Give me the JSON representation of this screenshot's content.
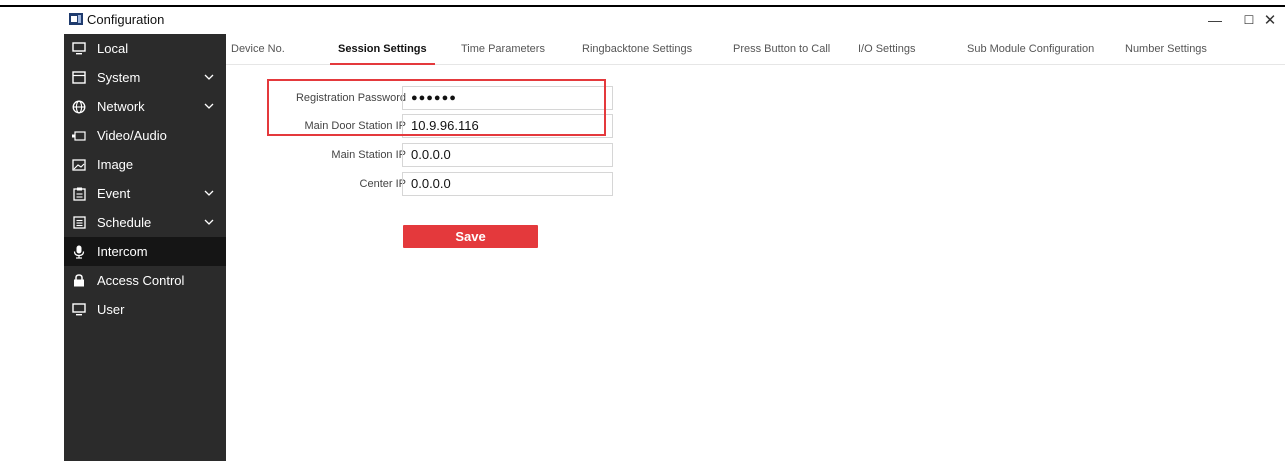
{
  "window": {
    "title": "Configuration",
    "minimize_label": "—",
    "maximize_label": "☐",
    "close_label": "✕"
  },
  "sidebar": {
    "items": [
      {
        "label": "Local",
        "icon": "monitor-icon"
      },
      {
        "label": "System",
        "icon": "system-icon",
        "expandable": true
      },
      {
        "label": "Network",
        "icon": "globe-icon",
        "expandable": true
      },
      {
        "label": "Video/Audio",
        "icon": "video-icon"
      },
      {
        "label": "Image",
        "icon": "image-icon"
      },
      {
        "label": "Event",
        "icon": "event-icon",
        "expandable": true
      },
      {
        "label": "Schedule",
        "icon": "schedule-icon",
        "expandable": true
      },
      {
        "label": "Intercom",
        "icon": "intercom-icon",
        "active": true
      },
      {
        "label": "Access Control",
        "icon": "lock-icon"
      },
      {
        "label": "User",
        "icon": "user-icon"
      }
    ]
  },
  "tabs": [
    {
      "label": "Device No."
    },
    {
      "label": "Session Settings",
      "active": true
    },
    {
      "label": "Time Parameters"
    },
    {
      "label": "Ringbacktone Settings"
    },
    {
      "label": "Press Button to Call"
    },
    {
      "label": "I/O Settings"
    },
    {
      "label": "Sub Module Configuration"
    },
    {
      "label": "Number Settings"
    }
  ],
  "form": {
    "registration_password": {
      "label": "Registration Password",
      "value": "●●●●●●"
    },
    "main_door_station_ip": {
      "label": "Main Door Station IP",
      "value": "10.9.96.116"
    },
    "main_station_ip": {
      "label": "Main Station IP",
      "value": "0.0.0.0"
    },
    "center_ip": {
      "label": "Center IP",
      "value": "0.0.0.0"
    },
    "save_label": "Save"
  },
  "colors": {
    "accent": "#e4393c",
    "sidebar_bg": "#2b2b2b",
    "sidebar_active": "#151515"
  }
}
